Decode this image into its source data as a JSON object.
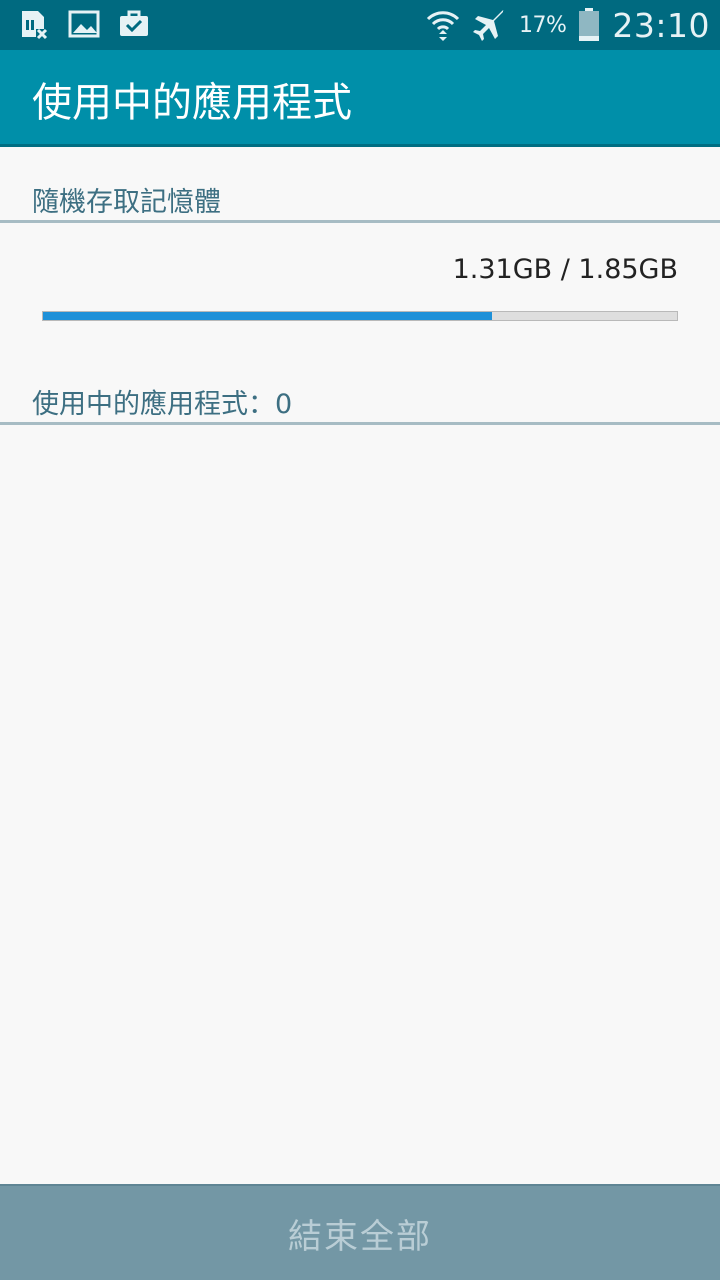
{
  "status_bar": {
    "left_icons": [
      "sim-error-icon",
      "image-icon",
      "briefcase-check-icon"
    ],
    "right_icons": [
      "wifi-icon",
      "airplane-mode-icon",
      "battery-icon"
    ],
    "battery_percent": "17%",
    "battery_level": 0.17,
    "time": "23:10"
  },
  "header": {
    "title": "使用中的應用程式"
  },
  "memory": {
    "section_title": "隨機存取記憶體",
    "usage_text": "1.31GB / 1.85GB",
    "used_fraction": 0.708
  },
  "apps": {
    "section_title": "使用中的應用程式：0"
  },
  "footer": {
    "end_all_label": "結束全部"
  },
  "colors": {
    "status_bar": "#006a80",
    "action_bar": "#008fa9",
    "progress_fill": "#1e90d8",
    "section_text": "#3d6f82",
    "footer_button": "#7397a5"
  }
}
